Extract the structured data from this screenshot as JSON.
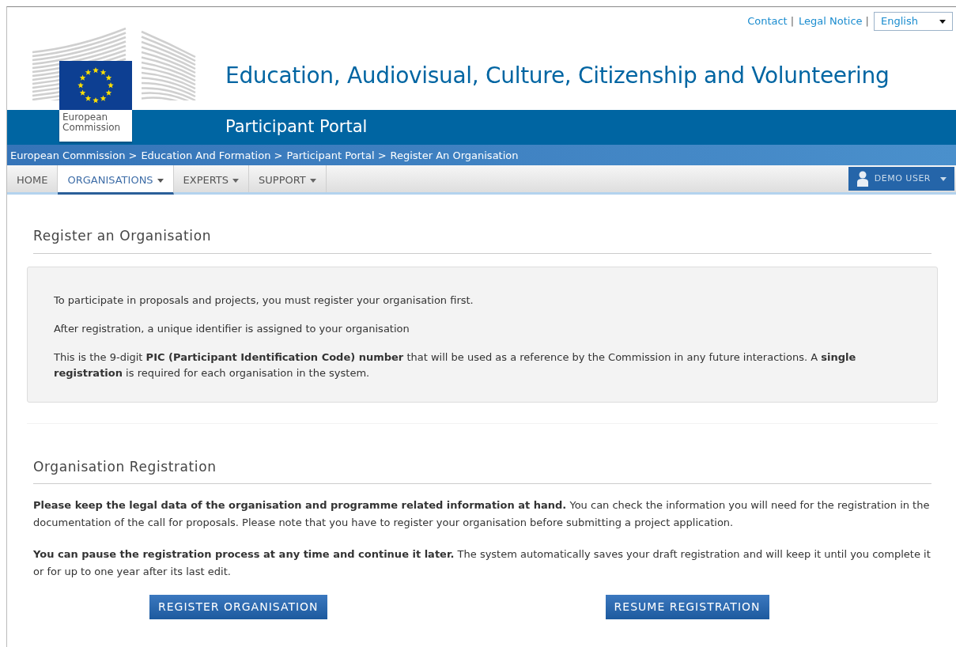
{
  "top_links": [
    {
      "label": "Contact",
      "separator": "|"
    },
    {
      "label": "Legal Notice",
      "separator": "|"
    }
  ],
  "language": {
    "value": "English"
  },
  "logo": {
    "text": "European Commission"
  },
  "site_title": "Education, Audiovisual, Culture, Citizenship and Volunteering",
  "portal_name": "Participant Portal",
  "breadcrumb": [
    {
      "label": "European Commission",
      "separator": ">"
    },
    {
      "label": "Education And Formation",
      "separator": ">"
    },
    {
      "label": "Participant Portal",
      "separator": ">"
    },
    {
      "label": "Register An Organisation"
    }
  ],
  "nav": [
    {
      "label": "HOME",
      "has_caret": false,
      "selected": false
    },
    {
      "label": "ORGANISATIONS",
      "has_caret": true,
      "selected": true
    },
    {
      "label": "EXPERTS",
      "has_caret": true,
      "selected": false
    },
    {
      "label": "SUPPORT",
      "has_caret": true,
      "selected": false
    }
  ],
  "user_menu": {
    "label": "DEMO USER"
  },
  "intro": {
    "title": "Register an Organisation",
    "paragraphs": [
      "To participate in proposals and projects, you must register your organisation first.",
      "After registration, a unique identifier is assigned to your organisation",
      "This is the 9-digit **PIC (Participant Identification Code) number** that will be used as a reference by the Commission in any future interactions. A **single registration** is required for each organisation in the system."
    ]
  },
  "registration": {
    "title": "Organisation Registration",
    "paragraphs": [
      "**Please keep the legal data of the organisation and programme related information at hand.** You can check the information you will need for the registration in the documentation of the call for proposals. Please note that you have to register your organisation before submitting a project application.",
      "**You can pause the registration process at any time and continue it later.** The system automatically saves your draft registration and will keep it until you complete it or for up to one year after its last edit."
    ],
    "buttons": [
      {
        "label": "REGISTER ORGANISATION"
      },
      {
        "label": "RESUME REGISTRATION"
      }
    ]
  }
}
